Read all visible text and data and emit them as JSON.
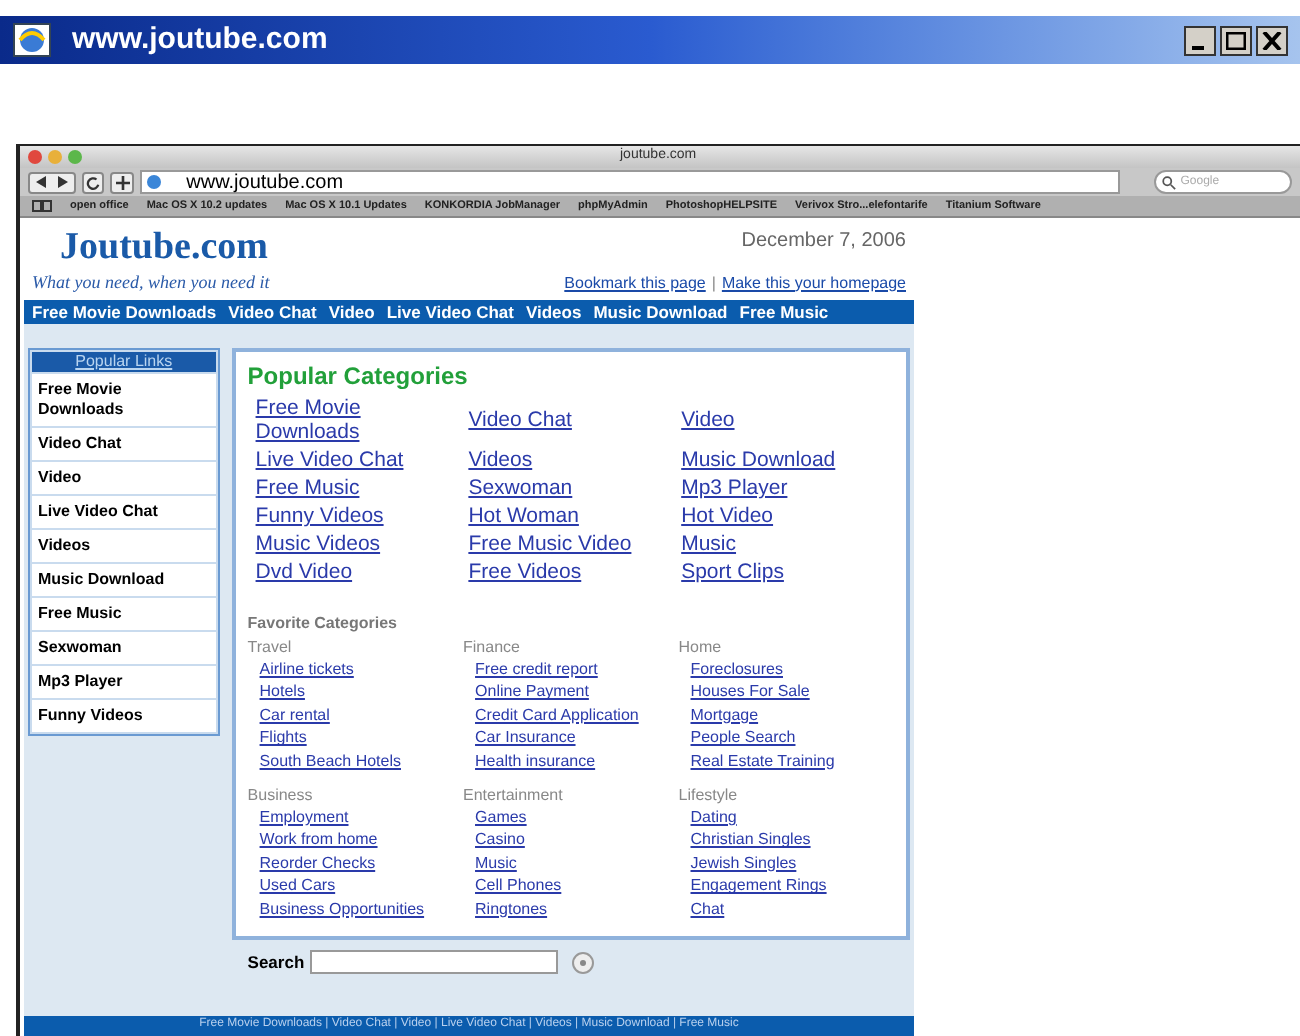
{
  "outer_window": {
    "title": "www.joutube.com"
  },
  "browser": {
    "title": "joutube.com",
    "address": "www.joutube.com",
    "search_placeholder": "Google",
    "bookmarks": [
      "open office",
      "Mac OS X 10.2 updates",
      "Mac OS X 10.1 Updates",
      "KONKORDIA JobManager",
      "phpMyAdmin",
      "PhotoshopHELPSITE",
      "Verivox Stro...elefontarife",
      "Titanium Software"
    ]
  },
  "site": {
    "logo": "Joutube.com",
    "tagline": "What you need, when you need it",
    "date": "December 7, 2006",
    "top_links": [
      "Bookmark this page",
      "Make this your homepage"
    ],
    "top_links_separator": "|",
    "nav": [
      "Free Movie Downloads",
      "Video Chat",
      "Video",
      "Live Video Chat",
      "Videos",
      "Music Download",
      "Free Music"
    ],
    "sidebar": {
      "title": "Popular Links",
      "items": [
        "Free Movie Downloads",
        "Video Chat",
        "Video",
        "Live Video Chat",
        "Videos",
        "Music Download",
        "Free Music",
        "Sexwoman",
        "Mp3 Player",
        "Funny Videos"
      ]
    },
    "popular": {
      "title": "Popular Categories",
      "links": [
        "Free Movie Downloads",
        "Video Chat",
        "Video",
        "Live Video Chat",
        "Videos",
        "Music Download",
        "Free Music",
        "Sexwoman",
        "Mp3 Player",
        "Funny Videos",
        "Hot Woman",
        "Hot Video",
        "Music Videos",
        "Free Music Video",
        "Music",
        "Dvd Video",
        "Free Videos",
        "Sport Clips"
      ]
    },
    "favorite": {
      "title": "Favorite Categories",
      "groups": [
        {
          "title": "Travel",
          "links": [
            "Airline tickets",
            "Hotels",
            "Car rental",
            "Flights",
            "South Beach Hotels"
          ]
        },
        {
          "title": "Finance",
          "links": [
            "Free credit report",
            "Online Payment",
            "Credit Card Application",
            "Car Insurance",
            "Health insurance"
          ]
        },
        {
          "title": "Home",
          "links": [
            "Foreclosures",
            "Houses For Sale",
            "Mortgage",
            "People Search",
            "Real Estate Training"
          ]
        },
        {
          "title": "Business",
          "links": [
            "Employment",
            "Work from home",
            "Reorder Checks",
            "Used Cars",
            "Business Opportunities"
          ]
        },
        {
          "title": "Entertainment",
          "links": [
            "Games",
            "Casino",
            "Music",
            "Cell Phones",
            "Ringtones"
          ]
        },
        {
          "title": "Lifestyle",
          "links": [
            "Dating",
            "Christian Singles",
            "Jewish Singles",
            "Engagement Rings",
            "Chat"
          ]
        }
      ]
    },
    "search": {
      "label": "Search"
    },
    "footer": "Free Movie Downloads | Video Chat | Video | Live Video Chat | Videos | Music Download | Free Music"
  }
}
